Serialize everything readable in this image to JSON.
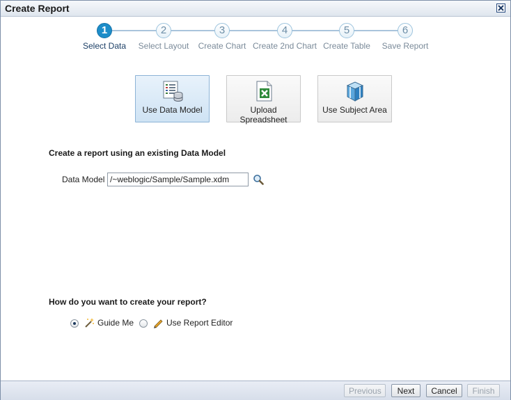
{
  "window": {
    "title": "Create Report"
  },
  "train": {
    "steps": [
      {
        "number": "1",
        "label": "Select Data",
        "active": true
      },
      {
        "number": "2",
        "label": "Select Layout"
      },
      {
        "number": "3",
        "label": "Create Chart"
      },
      {
        "number": "4",
        "label": "Create 2nd Chart"
      },
      {
        "number": "5",
        "label": "Create Table"
      },
      {
        "number": "6",
        "label": "Save Report"
      }
    ]
  },
  "options": [
    {
      "label": "Use Data Model",
      "icon": "data-model-icon",
      "selected": true
    },
    {
      "label": "Upload Spreadsheet",
      "icon": "spreadsheet-icon"
    },
    {
      "label": "Use Subject Area",
      "icon": "subject-area-icon"
    }
  ],
  "data_model_section": {
    "heading": "Create a report using an existing Data Model",
    "field_label": "Data Model",
    "field_value": "/~weblogic/Sample/Sample.xdm",
    "search_icon": "search-icon"
  },
  "creation_method": {
    "heading": "How do you want to create your report?",
    "choices": [
      {
        "label": "Guide Me",
        "icon": "magic-wand-icon",
        "checked": true
      },
      {
        "label": "Use Report Editor",
        "icon": "pencil-icon",
        "checked": false
      }
    ]
  },
  "footer": {
    "previous": "Previous",
    "next": "Next",
    "cancel": "Cancel",
    "finish": "Finish"
  },
  "colors": {
    "active_step": "#1d8dc9",
    "selected_tile": "#cfe3f4",
    "footer": "#d7deea"
  }
}
